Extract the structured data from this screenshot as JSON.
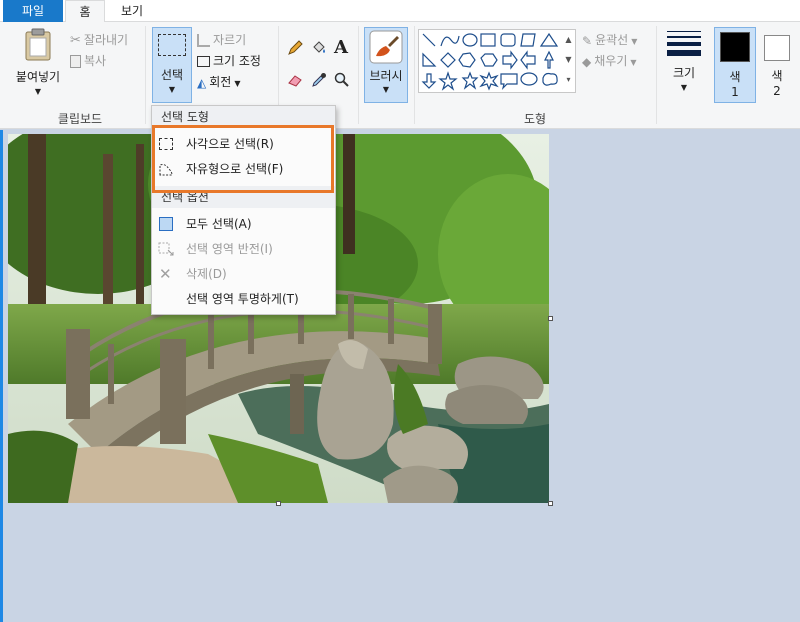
{
  "tabs": {
    "file": "파일",
    "home": "홈",
    "view": "보기"
  },
  "clipboard": {
    "paste": "붙여넣기",
    "cut": "잘라내기",
    "copy": "복사",
    "group": "클립보드"
  },
  "image_group": {
    "select": "선택",
    "crop": "자르기",
    "resize": "크기 조정",
    "rotate": "회전"
  },
  "tools": {},
  "brushes": {
    "label": "브러시"
  },
  "shapes": {
    "group": "도형",
    "outline": "윤곽선",
    "fill": "채우기"
  },
  "size": {
    "label": "크기"
  },
  "colors": {
    "color1_label": "색",
    "color1_num": "1",
    "color2_label": "색",
    "color2_num": "2",
    "color1_value": "#000000",
    "color2_value": "#ffffff"
  },
  "select_menu": {
    "header_shapes": "선택 도형",
    "rect_select": "사각으로 선택(R)",
    "free_select": "자유형으로 선택(F)",
    "header_options": "선택 옵션",
    "select_all": "모두 선택(A)",
    "invert": "선택 영역 반전(I)",
    "delete": "삭제(D)",
    "transparent": "선택 영역 투명하게(T)"
  },
  "accent": "#1979ca",
  "highlight_color": "#e8782a"
}
